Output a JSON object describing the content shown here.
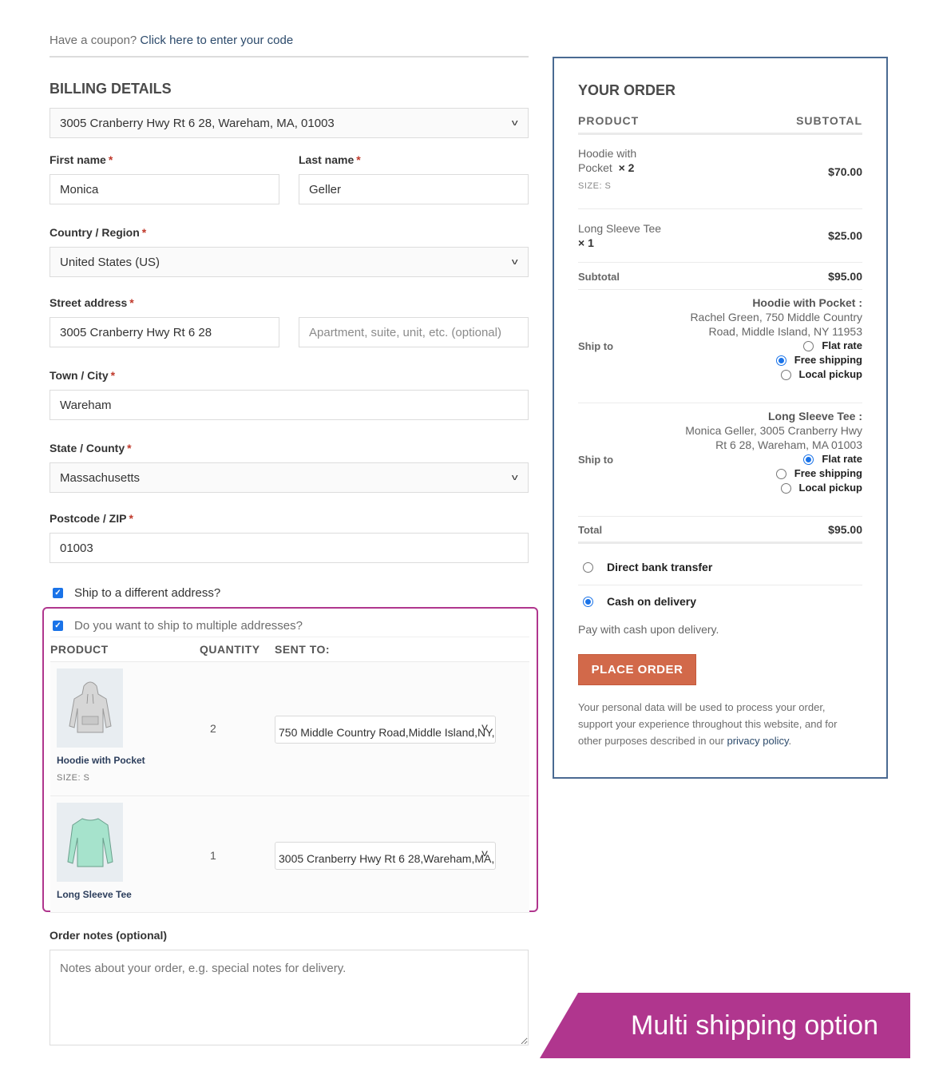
{
  "coupon": {
    "prompt": "Have a coupon?",
    "link": "Click here to enter your code"
  },
  "billing": {
    "title": "BILLING DETAILS",
    "saved_address": "3005 Cranberry Hwy Rt 6 28, Wareham, MA, 01003",
    "first_name": {
      "label": "First name",
      "value": "Monica"
    },
    "last_name": {
      "label": "Last name",
      "value": "Geller"
    },
    "country": {
      "label": "Country / Region",
      "value": "United States (US)"
    },
    "street": {
      "label": "Street address",
      "value": "3005 Cranberry Hwy Rt 6 28",
      "apt_placeholder": "Apartment, suite, unit, etc. (optional)"
    },
    "city": {
      "label": "Town / City",
      "value": "Wareham"
    },
    "state": {
      "label": "State / County",
      "value": "Massachusetts"
    },
    "zip": {
      "label": "Postcode / ZIP",
      "value": "01003"
    },
    "required_mark": "*"
  },
  "ship_different": {
    "label": "Ship to a different address?",
    "checked": true
  },
  "multi_ship": {
    "label": "Do you want to ship to multiple addresses?",
    "checked": true,
    "headers": {
      "product": "PRODUCT",
      "quantity": "QUANTITY",
      "sent_to": "SENT TO:"
    },
    "rows": [
      {
        "name": "Hoodie with Pocket",
        "size": "SIZE:  S",
        "qty": "2",
        "address": "750 Middle Country Road,Middle Island,NY,"
      },
      {
        "name": "Long Sleeve Tee",
        "size": "",
        "qty": "1",
        "address": "3005 Cranberry Hwy Rt 6 28,Wareham,MA,"
      }
    ]
  },
  "notes": {
    "label": "Order notes (optional)",
    "placeholder": "Notes about your order, e.g. special notes for delivery."
  },
  "order": {
    "title": "YOUR ORDER",
    "col_product": "PRODUCT",
    "col_subtotal": "SUBTOTAL",
    "items": [
      {
        "name_line1": "Hoodie with",
        "name_line2": "Pocket",
        "qty": "× 2",
        "meta": "SIZE:  S",
        "price": "$70.00"
      },
      {
        "name_line1": "Long Sleeve Tee",
        "qty": "× 1",
        "price": "$25.00"
      }
    ],
    "subtotal_label": "Subtotal",
    "subtotal": "$95.00",
    "shipping": [
      {
        "label": "Ship to",
        "product": "Hoodie with Pocket :",
        "address_line1": "Rachel Green, 750 Middle Country",
        "address_line2": "Road, Middle Island, NY 11953",
        "options": [
          {
            "label": "Flat rate",
            "selected": false
          },
          {
            "label": "Free shipping",
            "selected": true
          },
          {
            "label": "Local pickup",
            "selected": false
          }
        ]
      },
      {
        "label": "Ship to",
        "product": "Long Sleeve Tee :",
        "address_line1": "Monica Geller, 3005 Cranberry Hwy",
        "address_line2": "Rt 6 28, Wareham, MA 01003",
        "options": [
          {
            "label": "Flat rate",
            "selected": true
          },
          {
            "label": "Free shipping",
            "selected": false
          },
          {
            "label": "Local pickup",
            "selected": false
          }
        ]
      }
    ],
    "total_label": "Total",
    "total": "$95.00",
    "payment": [
      {
        "label": "Direct bank transfer",
        "selected": false
      },
      {
        "label": "Cash on delivery",
        "selected": true
      }
    ],
    "payment_desc": "Pay with cash upon delivery.",
    "place_order": "PLACE ORDER",
    "privacy_text": "Your personal data will be used to process your order, support your experience throughout this website, and for other purposes described in our",
    "privacy_link": "privacy policy",
    "privacy_end": "."
  },
  "banner": {
    "text": "Multi shipping option",
    "color": "#b0368e"
  },
  "colors": {
    "accent": "#d2694a",
    "panel_border": "#4a6a92",
    "link": "#2c4a6b",
    "radio": "#1a73e8"
  }
}
